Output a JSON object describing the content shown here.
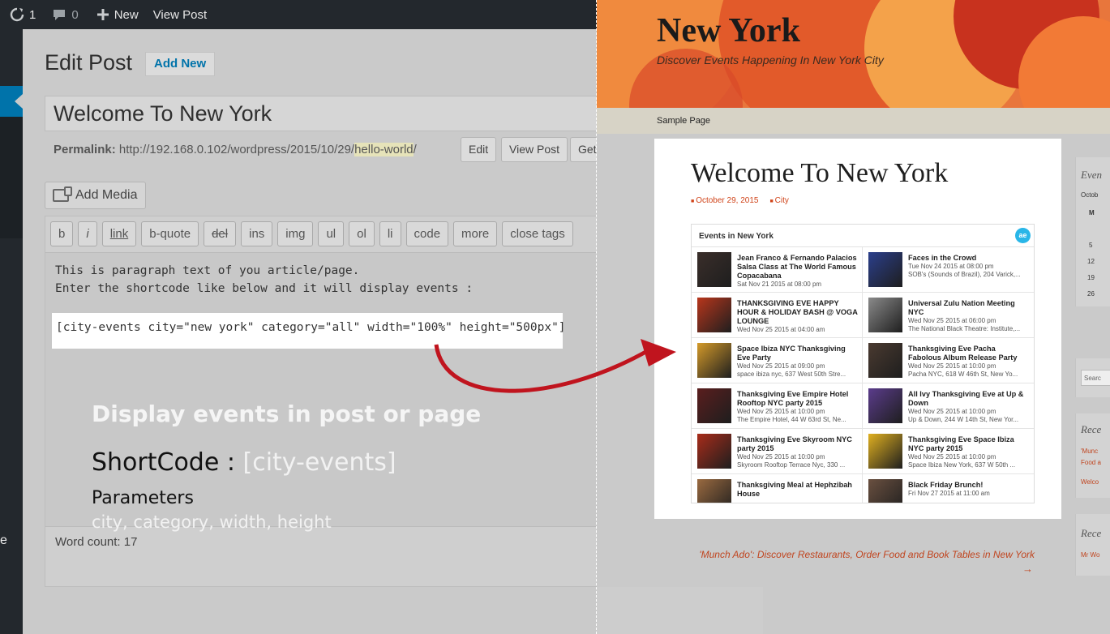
{
  "admin_bar": {
    "updates_count": "1",
    "comments_count": "0",
    "new_label": "New",
    "view_post_label": "View Post"
  },
  "sidebar": {
    "partial_label": "e"
  },
  "editor": {
    "page_title": "Edit Post",
    "add_new_label": "Add New",
    "post_title": "Welcome To New York",
    "permalink_label": "Permalink:",
    "permalink_base": "http://192.168.0.102/wordpress/2015/10/29/",
    "permalink_slug": "hello-world",
    "permalink_end": "/",
    "edit_btn": "Edit",
    "view_post_btn": "View Post",
    "get_btn": "Get",
    "add_media_label": "Add Media",
    "quicktags": [
      "b",
      "i",
      "link",
      "b-quote",
      "del",
      "ins",
      "img",
      "ul",
      "ol",
      "li",
      "code",
      "more",
      "close tags"
    ],
    "line1": "This is paragraph text of you article/page.",
    "line2": "Enter the shortcode like below and it will display events :",
    "shortcode": "[city-events city=\"new york\" category=\"all\" width=\"100%\" height=\"500px\"]",
    "word_count": "Word count: 17"
  },
  "overlay": {
    "heading": "Display events in post or page",
    "shortcode_label": "ShortCode :",
    "shortcode_value": "[city-events]",
    "parameters_label": "Parameters",
    "parameters_list": "city, category, width, height"
  },
  "site": {
    "title": "New York",
    "tagline": "Discover Events Happening In New York City",
    "nav_item": "Sample Page",
    "post_title": "Welcome To New York",
    "post_date": "October 29, 2015",
    "post_category": "City",
    "widget_title": "Events in New York",
    "widget_logo": "ae",
    "events": [
      {
        "title": "Jean Franco & Fernando Palacios Salsa Class at The World Famous Copacabana",
        "date": "Sat Nov 21 2015 at 08:00 pm",
        "venue": "",
        "color": "#3a2e2a"
      },
      {
        "title": "Faces in the Crowd",
        "date": "Tue Nov 24 2015 at 08:00 pm",
        "venue": "SOB's (Sounds of Brazil), 204 Varick,...",
        "color": "#2b3f8c"
      },
      {
        "title": "THANKSGIVING EVE HAPPY HOUR & HOLIDAY BASH @ VOGA LOUNGE",
        "date": "Wed Nov 25 2015 at 04:00 am",
        "venue": "",
        "color": "#b8361c"
      },
      {
        "title": "Universal Zulu Nation Meeting NYC",
        "date": "Wed Nov 25 2015 at 06:00 pm",
        "venue": "The National Black Theatre: Institute,...",
        "color": "#8a8a8a"
      },
      {
        "title": "Space Ibiza NYC Thanksgiving Eve Party",
        "date": "Wed Nov 25 2015 at 09:00 pm",
        "venue": "space ibiza nyc, 637 West 50th Stre...",
        "color": "#d49a2a"
      },
      {
        "title": "Thanksgiving Eve Pacha Fabolous Album Release Party",
        "date": "Wed Nov 25 2015 at 10:00 pm",
        "venue": "Pacha NYC, 618 W 46th St, New Yo...",
        "color": "#4a3a30"
      },
      {
        "title": "Thanksgiving Eve Empire Hotel Rooftop NYC party 2015",
        "date": "Wed Nov 25 2015 at 10:00 pm",
        "venue": "The Empire Hotel, 44 W 63rd St, Ne...",
        "color": "#5a1e1e"
      },
      {
        "title": "All Ivy Thanksgiving Eve at Up & Down",
        "date": "Wed Nov 25 2015 at 10:00 pm",
        "venue": "Up & Down, 244 W 14th St, New Yor...",
        "color": "#5b3c8c"
      },
      {
        "title": "Thanksgiving Eve Skyroom NYC party 2015",
        "date": "Wed Nov 25 2015 at 10:00 pm",
        "venue": "Skyroom Rooftop Terrace Nyc, 330 ...",
        "color": "#a82c1a"
      },
      {
        "title": "Thanksgiving Eve Space Ibiza NYC party 2015",
        "date": "Wed Nov 25 2015 at 10:00 pm",
        "venue": "Space Ibiza New York, 637 W 50th ...",
        "color": "#e0b020"
      },
      {
        "title": "Thanksgiving Meal at Hephzibah House",
        "date": "",
        "venue": "",
        "color": "#9a6a40"
      },
      {
        "title": "Black Friday Brunch!",
        "date": "Fri Nov 27 2015 at 11:00 am",
        "venue": "",
        "color": "#6a5040"
      }
    ],
    "next_post": "'Munch Ado': Discover Restaurants, Order Food and Book Tables in New York",
    "next_arrow": "→",
    "sidebar": {
      "events_head": "Even",
      "month": "Octob",
      "weekday": "M",
      "days": [
        "5",
        "12",
        "19",
        "26"
      ],
      "search_placeholder": "Searc",
      "recent_head": "Rece",
      "recent_1": "'Munc",
      "recent_2": "Food a",
      "recent_3": "Welco",
      "recent2_head": "Rece",
      "recent2_1": "Mr Wo"
    }
  },
  "colors": {
    "admin_bar": "#23282d",
    "wp_blue": "#0073aa",
    "site_accent": "#c0441e",
    "arrow_red": "#c0141e"
  }
}
